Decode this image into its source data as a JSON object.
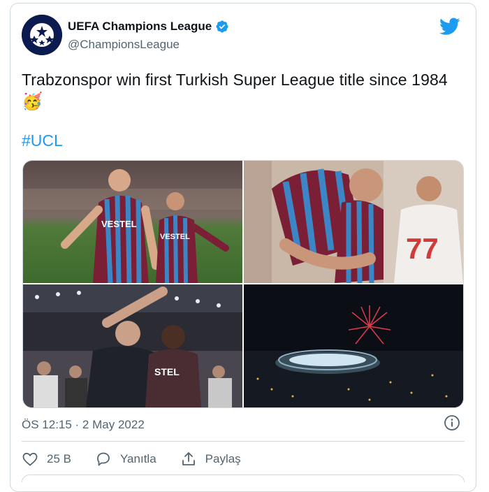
{
  "tweet": {
    "author": {
      "name": "UEFA Champions League",
      "handle": "@ChampionsLeague",
      "verified": true
    },
    "text": "Trabzonspor win first Turkish Super League title since 1984",
    "emoji": "🥳",
    "hashtag": "#UCL",
    "timestamp": "ÖS 12:15 · 2 May 2022"
  },
  "actions": {
    "likes": "25 B",
    "reply_label": "Yanıtla",
    "share_label": "Paylaş"
  },
  "colors": {
    "accent": "#1d9bf0",
    "text": "#0f1419",
    "muted": "#536471",
    "border": "#cfd9de",
    "trabzon_claret": "#7a1f35",
    "trabzon_blue": "#3d86c6"
  },
  "icons": {
    "brand": "twitter-bird-icon",
    "verified": "verified-badge-icon",
    "info": "info-icon",
    "like": "heart-icon",
    "reply": "reply-bubble-icon",
    "share": "share-upload-icon"
  }
}
